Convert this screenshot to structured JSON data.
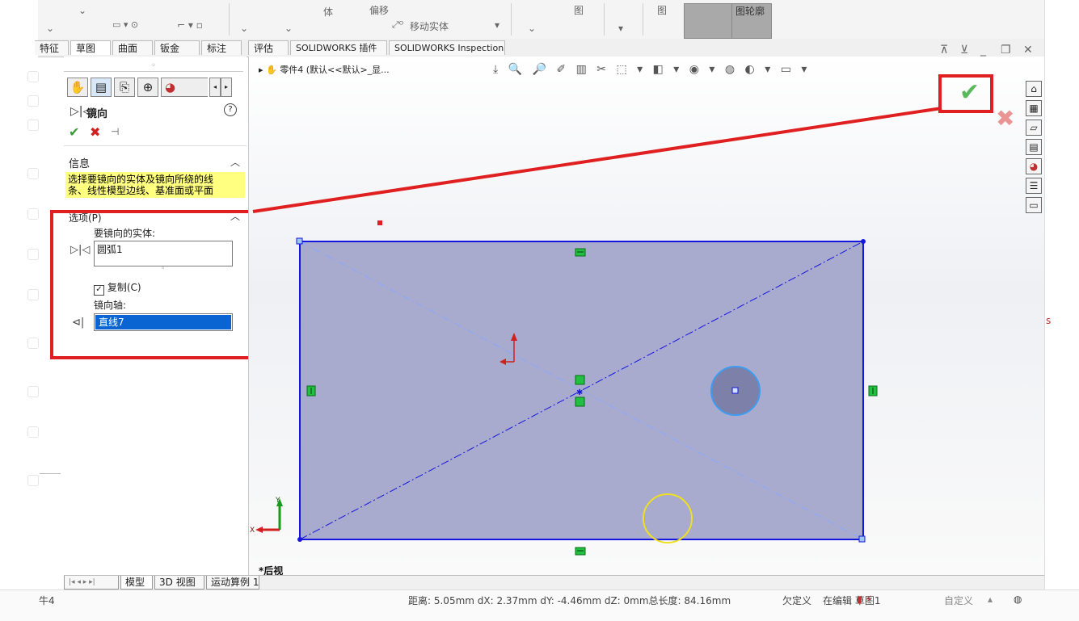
{
  "ribbon": {
    "items": [
      "体",
      "偏移",
      "移动实体",
      "图",
      "图",
      "图轮廓"
    ]
  },
  "tabs": [
    "特征",
    "草图",
    "曲面",
    "钣金",
    "标注",
    "评估",
    "SOLIDWORKS 插件",
    "SOLIDWORKS Inspection"
  ],
  "tree": {
    "item": "零件4 (默认<<默认>_显..."
  },
  "pm": {
    "title": "镜向",
    "info_header": "信息",
    "info_text_line1": "选择要镜向的实体及镜向所绕的线",
    "info_text_line2": "条、线性模型边线、基准面或平面",
    "options_header": "选项(P)",
    "entities_label": "要镜向的实体:",
    "entity_value": "圆弧1",
    "copy_label": "复制(C)",
    "copy_checked": true,
    "axis_label": "镜向轴:",
    "axis_value": "直线7"
  },
  "view": {
    "label": "*后视"
  },
  "bottom_tabs": [
    "模型",
    "3D 视图",
    "运动算例 1"
  ],
  "status": {
    "left": "牛4",
    "measure": "距离: 5.05mm dX: 2.37mm dY: -4.46mm dZ: 0mm总长度: 84.16mm",
    "state": "欠定义",
    "editing": "在编辑 草图1",
    "custom": "自定义"
  },
  "colors": {
    "annotation_red": "#e02020",
    "accept_green": "#5cb85c",
    "cancel_red": "#e05050",
    "sketch_blue": "#1515e0",
    "fill_lavender": "#9b9ec7",
    "highlight_yellow": "#ffff80",
    "selection_blue": "#0a64d2"
  },
  "icons": [
    "part-icon",
    "feature-manager-icon",
    "property-manager-icon",
    "configuration-manager-icon",
    "dimxpert-icon",
    "appearance-icon",
    "help-icon",
    "accept-icon",
    "cancel-icon",
    "pin-icon",
    "mirror-icon",
    "home-icon",
    "view-cube-icon",
    "folder-icon",
    "palette-icon",
    "custom-properties-icon",
    "chat-icon"
  ]
}
